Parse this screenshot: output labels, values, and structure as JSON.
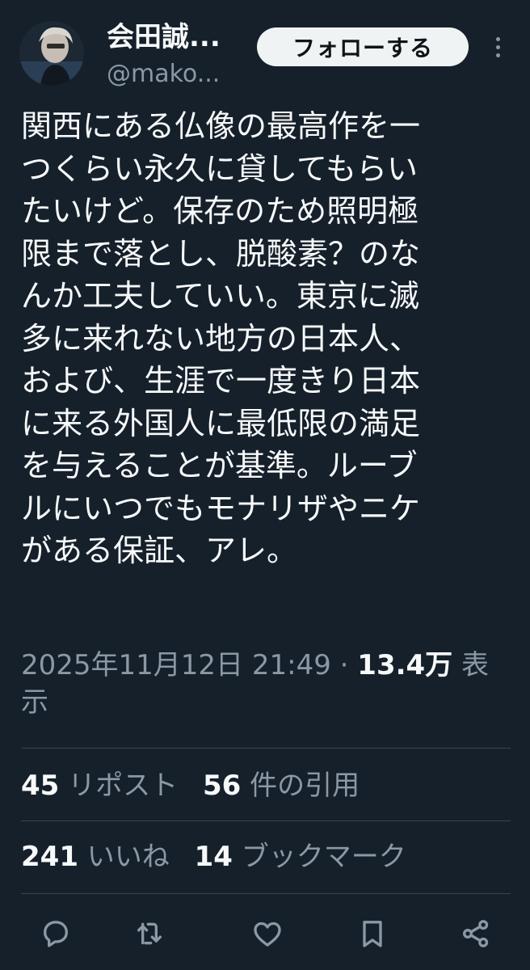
{
  "author": {
    "display_name": "会田誠...",
    "handle": "@mako..."
  },
  "follow_button_label": "フォローする",
  "tweet": {
    "lines": [
      "関西にある仏像の最高作を一",
      "つくらい永久に貸してもらい",
      "たいけど。保存のため照明極",
      "限まで落とし、脱酸素？のな",
      "んか工夫していい。東京に滅",
      "多に来れない地方の日本人、",
      "および、生涯で一度きり日本",
      "に来る外国人に最低限の満足",
      "を与えることが基準。ルーブ",
      "ルにいつでもモナリザやニケ",
      "がある保証、アレ。"
    ]
  },
  "meta": {
    "timestamp": "2025年11月12日 21:49 · ",
    "views_count": "13.4万",
    "views_label": " 表示"
  },
  "stats": {
    "reposts_count": "45",
    "reposts_label": "リポスト",
    "quotes_count": "56",
    "quotes_label": "件の引用",
    "likes_count": "241",
    "likes_label": "いいね",
    "bookmarks_count": "14",
    "bookmarks_label": "ブックマーク"
  },
  "actions": [
    "reply-icon",
    "retweet-icon",
    "like-icon",
    "bookmark-icon",
    "share-icon"
  ],
  "colors": {
    "background": "#15202b",
    "text": "#f7f9f9",
    "secondary_text": "#8b98a5",
    "divider": "#38444d",
    "follow_button_bg": "#eff3f4"
  }
}
